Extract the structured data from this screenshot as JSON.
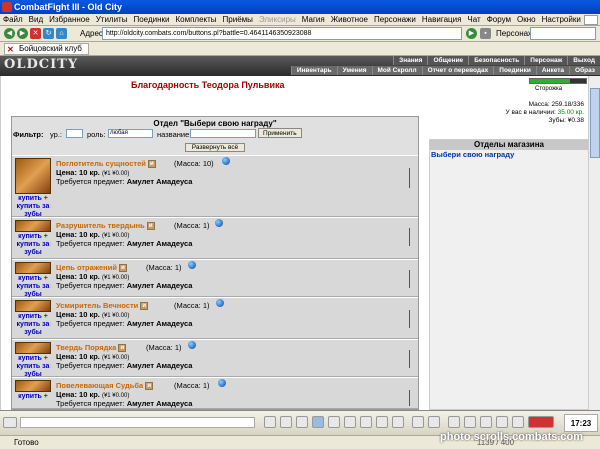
{
  "window": {
    "title": "CombatFight III - Old City"
  },
  "menu": [
    "Файл",
    "Вид",
    "Избранное",
    "Утилиты",
    "Поединки",
    "Комплекты",
    "Приёмы",
    "Эликсиры",
    "Магия",
    "Животное",
    "Персонажи",
    "Навигация",
    "Чат",
    "Форум",
    "Окно",
    "Настройки",
    "?"
  ],
  "toolbar": {
    "address_label": "Адрес",
    "address": "http://oldcity.combats.com/buttons.pl?battle=0.4641146350923088",
    "persona_label": "Персонаж:"
  },
  "tab": {
    "label": "Бойцовский клуб"
  },
  "header": {
    "logo": "OLDCITY",
    "nav_top": [
      "Знания",
      "Общение",
      "Безопасность",
      "Персонаж",
      "Выход"
    ],
    "nav_bottom": [
      "Инвентарь",
      "Умения",
      "Мой Скролл",
      "Отчет о переводах",
      "Поединки",
      "Анкета",
      "Образ"
    ]
  },
  "page": {
    "title": "Благодарность Теодора Пульвика",
    "storozhka": "Сторожка",
    "mass_line": "Масса: 259.18/336",
    "have_prefix": "У вас в наличии: ",
    "have_value": "35.00 кр.",
    "teeth_line": "Зубы: ¥0.38"
  },
  "panel": {
    "heading": "Отдел \"Выбери свою награду\"",
    "filter_label": "Фильтр:",
    "level_label": "ур.:",
    "role_label": "роль:",
    "role_value": "любая",
    "name_label": "название:",
    "apply_btn": "Применить",
    "expand_btn": "Развернуть всё"
  },
  "items": [
    {
      "name": "Поглотитель сущностей",
      "mass": "(Масса: 10)",
      "price": "Цена: 10 кр.",
      "price_extra": "(¥1 ¥0.00)",
      "req_label": "Требуется предмет: ",
      "req_item": "Амулет Амадеуса"
    },
    {
      "name": "Разрушитель твердынь",
      "mass": "(Масса: 1)",
      "price": "Цена: 10 кр.",
      "price_extra": "(¥1 ¥0.00)",
      "req_label": "Требуется предмет: ",
      "req_item": "Амулет Амадеуса"
    },
    {
      "name": "Цепь отражений",
      "mass": "(Масса: 1)",
      "price": "Цена: 10 кр.",
      "price_extra": "(¥1 ¥0.00)",
      "req_label": "Требуется предмет: ",
      "req_item": "Амулет Амадеуса"
    },
    {
      "name": "Усмиритель Вечности",
      "mass": "(Масса: 1)",
      "price": "Цена: 10 кр.",
      "price_extra": "(¥1 ¥0.00)",
      "req_label": "Требуется предмет: ",
      "req_item": "Амулет Амадеуса"
    },
    {
      "name": "Твердь Порядка",
      "mass": "(Масса: 1)",
      "price": "Цена: 10 кр.",
      "price_extra": "(¥1 ¥0.00)",
      "req_label": "Требуется предмет: ",
      "req_item": "Амулет Амадеуса"
    },
    {
      "name": "Повелевающая Судьба",
      "mass": "(Масса: 1)",
      "price": "Цена: 10 кр.",
      "price_extra": "(¥1 ¥0.00)",
      "req_label": "Требуется предмет: ",
      "req_item": "Амулет Амадеуса"
    }
  ],
  "links": {
    "buy": "купить",
    "buy_teeth": "купить за зубы",
    "badge": "и",
    "plus": "+"
  },
  "sidebar": {
    "heading": "Отделы магазина",
    "link": "Выбери свою награду"
  },
  "status": {
    "text": "Готово",
    "right": "\"1139 / 400"
  },
  "taskbar": {
    "clock": "17:23"
  },
  "watermark": "photo.scrolls.combats.com",
  "colors": {
    "title_red": "#aa0000",
    "item_orange": "#cc6600",
    "link_blue": "#0000cc"
  }
}
